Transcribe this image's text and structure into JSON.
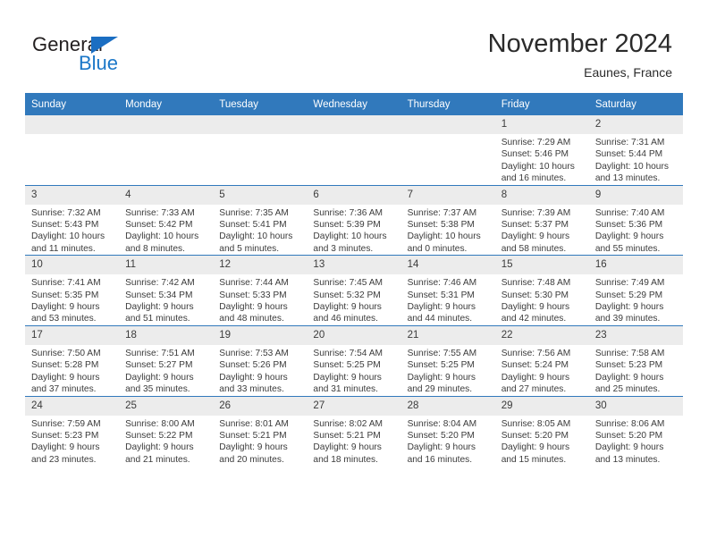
{
  "logo": {
    "word1": "General",
    "word2": "Blue",
    "triangle_color": "#1b6ec2",
    "word2_color": "#1b77c8"
  },
  "header": {
    "title": "November 2024",
    "subtitle": "Eaunes, France"
  },
  "theme": {
    "header_bg": "#3179bc",
    "daynum_bg": "#ececec",
    "text": "#3b3b3b"
  },
  "weekday_headers": [
    "Sunday",
    "Monday",
    "Tuesday",
    "Wednesday",
    "Thursday",
    "Friday",
    "Saturday"
  ],
  "labels": {
    "sunrise": "Sunrise:",
    "sunset": "Sunset:",
    "daylight": "Daylight:"
  },
  "weeks": [
    [
      {
        "day": "",
        "sunrise": "",
        "sunset": "",
        "daylight": ""
      },
      {
        "day": "",
        "sunrise": "",
        "sunset": "",
        "daylight": ""
      },
      {
        "day": "",
        "sunrise": "",
        "sunset": "",
        "daylight": ""
      },
      {
        "day": "",
        "sunrise": "",
        "sunset": "",
        "daylight": ""
      },
      {
        "day": "",
        "sunrise": "",
        "sunset": "",
        "daylight": ""
      },
      {
        "day": "1",
        "sunrise": "Sunrise: 7:29 AM",
        "sunset": "Sunset: 5:46 PM",
        "daylight": "Daylight: 10 hours and 16 minutes."
      },
      {
        "day": "2",
        "sunrise": "Sunrise: 7:31 AM",
        "sunset": "Sunset: 5:44 PM",
        "daylight": "Daylight: 10 hours and 13 minutes."
      }
    ],
    [
      {
        "day": "3",
        "sunrise": "Sunrise: 7:32 AM",
        "sunset": "Sunset: 5:43 PM",
        "daylight": "Daylight: 10 hours and 11 minutes."
      },
      {
        "day": "4",
        "sunrise": "Sunrise: 7:33 AM",
        "sunset": "Sunset: 5:42 PM",
        "daylight": "Daylight: 10 hours and 8 minutes."
      },
      {
        "day": "5",
        "sunrise": "Sunrise: 7:35 AM",
        "sunset": "Sunset: 5:41 PM",
        "daylight": "Daylight: 10 hours and 5 minutes."
      },
      {
        "day": "6",
        "sunrise": "Sunrise: 7:36 AM",
        "sunset": "Sunset: 5:39 PM",
        "daylight": "Daylight: 10 hours and 3 minutes."
      },
      {
        "day": "7",
        "sunrise": "Sunrise: 7:37 AM",
        "sunset": "Sunset: 5:38 PM",
        "daylight": "Daylight: 10 hours and 0 minutes."
      },
      {
        "day": "8",
        "sunrise": "Sunrise: 7:39 AM",
        "sunset": "Sunset: 5:37 PM",
        "daylight": "Daylight: 9 hours and 58 minutes."
      },
      {
        "day": "9",
        "sunrise": "Sunrise: 7:40 AM",
        "sunset": "Sunset: 5:36 PM",
        "daylight": "Daylight: 9 hours and 55 minutes."
      }
    ],
    [
      {
        "day": "10",
        "sunrise": "Sunrise: 7:41 AM",
        "sunset": "Sunset: 5:35 PM",
        "daylight": "Daylight: 9 hours and 53 minutes."
      },
      {
        "day": "11",
        "sunrise": "Sunrise: 7:42 AM",
        "sunset": "Sunset: 5:34 PM",
        "daylight": "Daylight: 9 hours and 51 minutes."
      },
      {
        "day": "12",
        "sunrise": "Sunrise: 7:44 AM",
        "sunset": "Sunset: 5:33 PM",
        "daylight": "Daylight: 9 hours and 48 minutes."
      },
      {
        "day": "13",
        "sunrise": "Sunrise: 7:45 AM",
        "sunset": "Sunset: 5:32 PM",
        "daylight": "Daylight: 9 hours and 46 minutes."
      },
      {
        "day": "14",
        "sunrise": "Sunrise: 7:46 AM",
        "sunset": "Sunset: 5:31 PM",
        "daylight": "Daylight: 9 hours and 44 minutes."
      },
      {
        "day": "15",
        "sunrise": "Sunrise: 7:48 AM",
        "sunset": "Sunset: 5:30 PM",
        "daylight": "Daylight: 9 hours and 42 minutes."
      },
      {
        "day": "16",
        "sunrise": "Sunrise: 7:49 AM",
        "sunset": "Sunset: 5:29 PM",
        "daylight": "Daylight: 9 hours and 39 minutes."
      }
    ],
    [
      {
        "day": "17",
        "sunrise": "Sunrise: 7:50 AM",
        "sunset": "Sunset: 5:28 PM",
        "daylight": "Daylight: 9 hours and 37 minutes."
      },
      {
        "day": "18",
        "sunrise": "Sunrise: 7:51 AM",
        "sunset": "Sunset: 5:27 PM",
        "daylight": "Daylight: 9 hours and 35 minutes."
      },
      {
        "day": "19",
        "sunrise": "Sunrise: 7:53 AM",
        "sunset": "Sunset: 5:26 PM",
        "daylight": "Daylight: 9 hours and 33 minutes."
      },
      {
        "day": "20",
        "sunrise": "Sunrise: 7:54 AM",
        "sunset": "Sunset: 5:25 PM",
        "daylight": "Daylight: 9 hours and 31 minutes."
      },
      {
        "day": "21",
        "sunrise": "Sunrise: 7:55 AM",
        "sunset": "Sunset: 5:25 PM",
        "daylight": "Daylight: 9 hours and 29 minutes."
      },
      {
        "day": "22",
        "sunrise": "Sunrise: 7:56 AM",
        "sunset": "Sunset: 5:24 PM",
        "daylight": "Daylight: 9 hours and 27 minutes."
      },
      {
        "day": "23",
        "sunrise": "Sunrise: 7:58 AM",
        "sunset": "Sunset: 5:23 PM",
        "daylight": "Daylight: 9 hours and 25 minutes."
      }
    ],
    [
      {
        "day": "24",
        "sunrise": "Sunrise: 7:59 AM",
        "sunset": "Sunset: 5:23 PM",
        "daylight": "Daylight: 9 hours and 23 minutes."
      },
      {
        "day": "25",
        "sunrise": "Sunrise: 8:00 AM",
        "sunset": "Sunset: 5:22 PM",
        "daylight": "Daylight: 9 hours and 21 minutes."
      },
      {
        "day": "26",
        "sunrise": "Sunrise: 8:01 AM",
        "sunset": "Sunset: 5:21 PM",
        "daylight": "Daylight: 9 hours and 20 minutes."
      },
      {
        "day": "27",
        "sunrise": "Sunrise: 8:02 AM",
        "sunset": "Sunset: 5:21 PM",
        "daylight": "Daylight: 9 hours and 18 minutes."
      },
      {
        "day": "28",
        "sunrise": "Sunrise: 8:04 AM",
        "sunset": "Sunset: 5:20 PM",
        "daylight": "Daylight: 9 hours and 16 minutes."
      },
      {
        "day": "29",
        "sunrise": "Sunrise: 8:05 AM",
        "sunset": "Sunset: 5:20 PM",
        "daylight": "Daylight: 9 hours and 15 minutes."
      },
      {
        "day": "30",
        "sunrise": "Sunrise: 8:06 AM",
        "sunset": "Sunset: 5:20 PM",
        "daylight": "Daylight: 9 hours and 13 minutes."
      }
    ]
  ]
}
